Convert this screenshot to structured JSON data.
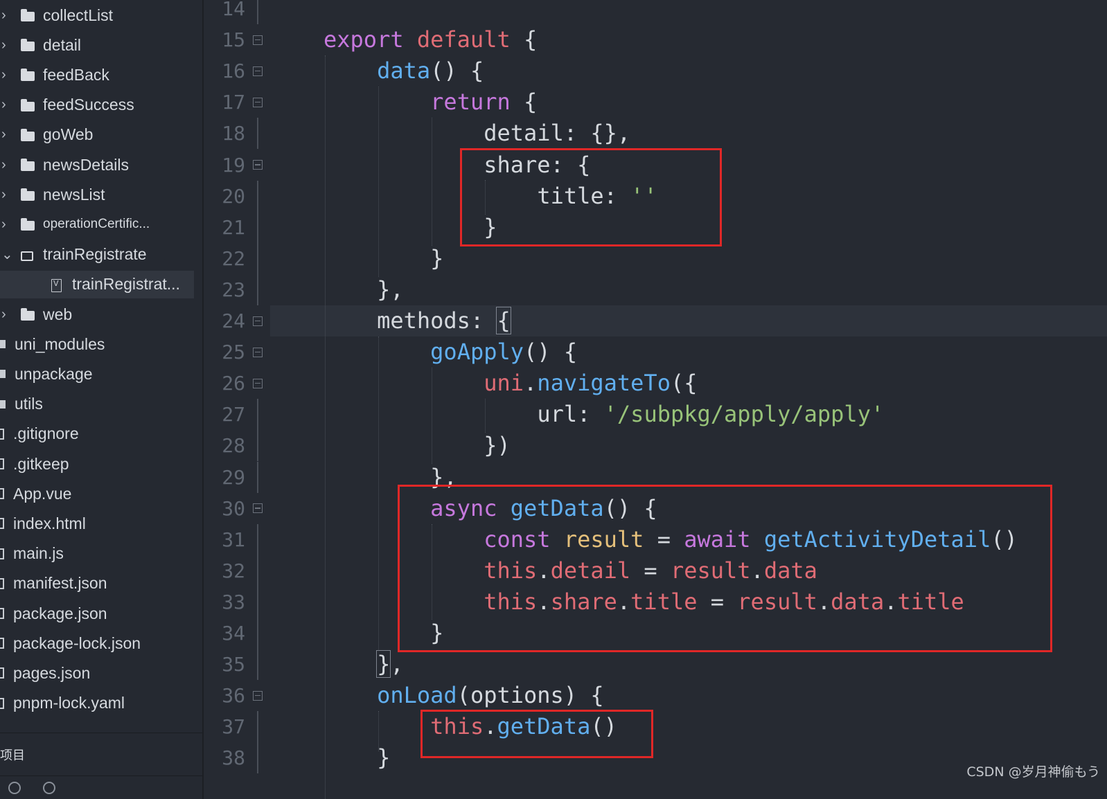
{
  "sidebar": {
    "items": [
      {
        "label": "collectList",
        "kind": "folder",
        "expanded": false
      },
      {
        "label": "detail",
        "kind": "folder",
        "expanded": false
      },
      {
        "label": "feedBack",
        "kind": "folder",
        "expanded": false
      },
      {
        "label": "feedSuccess",
        "kind": "folder",
        "expanded": false
      },
      {
        "label": "goWeb",
        "kind": "folder",
        "expanded": false
      },
      {
        "label": "newsDetails",
        "kind": "folder",
        "expanded": false
      },
      {
        "label": "newsList",
        "kind": "folder",
        "expanded": false
      },
      {
        "label": "operationCertific...",
        "kind": "folder",
        "expanded": false
      },
      {
        "label": "trainRegistrate",
        "kind": "folder",
        "expanded": true
      },
      {
        "label": "trainRegistrat...",
        "kind": "vue-file",
        "selected": true
      },
      {
        "label": "web",
        "kind": "folder",
        "expanded": false
      },
      {
        "label": "uni_modules",
        "kind": "root-folder"
      },
      {
        "label": "unpackage",
        "kind": "root-folder"
      },
      {
        "label": "utils",
        "kind": "root-folder"
      },
      {
        "label": ".gitignore",
        "kind": "root-file"
      },
      {
        "label": ".gitkeep",
        "kind": "root-file"
      },
      {
        "label": "App.vue",
        "kind": "root-file"
      },
      {
        "label": "index.html",
        "kind": "root-file"
      },
      {
        "label": "main.js",
        "kind": "root-file"
      },
      {
        "label": "manifest.json",
        "kind": "root-file"
      },
      {
        "label": "package.json",
        "kind": "root-file"
      },
      {
        "label": "package-lock.json",
        "kind": "root-file"
      },
      {
        "label": "pages.json",
        "kind": "root-file"
      },
      {
        "label": "pnpm-lock.yaml",
        "kind": "root-file"
      }
    ],
    "footer_label": "项目"
  },
  "editor": {
    "line_numbers": [
      "14",
      "15",
      "16",
      "17",
      "18",
      "19",
      "20",
      "21",
      "22",
      "23",
      "24",
      "25",
      "26",
      "27",
      "28",
      "29",
      "30",
      "31",
      "32",
      "33",
      "34",
      "35",
      "36",
      "37",
      "38"
    ],
    "code": {
      "l15": [
        "export",
        "default",
        "{"
      ],
      "l16": [
        "data",
        "() {"
      ],
      "l17": [
        "return",
        "{"
      ],
      "l18": [
        "detail",
        ": {},"
      ],
      "l19": [
        "share",
        ": {"
      ],
      "l20": [
        "title",
        ": ",
        "''"
      ],
      "l21": [
        "}"
      ],
      "l22": [
        "}"
      ],
      "l23": [
        "},"
      ],
      "l24": [
        "methods",
        ": ",
        "{"
      ],
      "l25": [
        "goApply",
        "() {"
      ],
      "l26": [
        "uni",
        ".",
        "navigateTo",
        "({"
      ],
      "l27": [
        "url",
        ": ",
        "'/subpkg/apply/apply'"
      ],
      "l28": [
        "})"
      ],
      "l29": [
        "},"
      ],
      "l30": [
        "async",
        "getData",
        "() {"
      ],
      "l31": [
        "const",
        "result",
        "=",
        "await",
        "getActivityDetail",
        "()"
      ],
      "l32": [
        "this",
        ".",
        "detail",
        "=",
        "result",
        ".",
        "data"
      ],
      "l33": [
        "this",
        ".",
        "share",
        ".",
        "title",
        "=",
        "result",
        ".",
        "data",
        ".",
        "title"
      ],
      "l34": [
        "}"
      ],
      "l35": [
        "}",
        ","
      ],
      "l36": [
        "onLoad",
        "(options) {"
      ],
      "l37": [
        "this",
        ".",
        "getData",
        "()"
      ],
      "l38": [
        "}"
      ]
    }
  },
  "watermark": "CSDN @岁月神偷もう"
}
